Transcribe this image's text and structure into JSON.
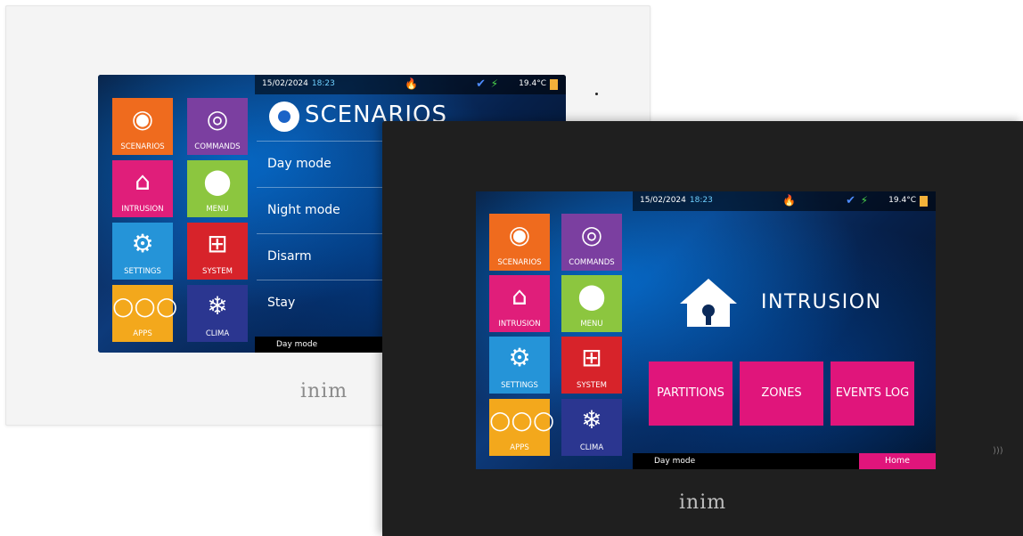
{
  "brand": "inim",
  "status": {
    "date": "15/02/2024",
    "time": "18:23",
    "temperature": "19.4°C"
  },
  "tiles": [
    {
      "label": "SCENARIOS",
      "icon": "eye-icon",
      "color": "#ef6b1e"
    },
    {
      "label": "COMMANDS",
      "icon": "touch-icon",
      "color": "#7b3fa0"
    },
    {
      "label": "INTRUSION",
      "icon": "house-icon",
      "color": "#e01e7a"
    },
    {
      "label": "MENU",
      "icon": "map-pin-icon",
      "color": "#8cc63f"
    },
    {
      "label": "SETTINGS",
      "icon": "gear-icon",
      "color": "#2594d8"
    },
    {
      "label": "SYSTEM",
      "icon": "network-icon",
      "color": "#d7232a"
    },
    {
      "label": "APPS",
      "icon": "dots-icon",
      "color": "#f3a81c"
    },
    {
      "label": "CLIMA",
      "icon": "snowflake-icon",
      "color": "#2b3690"
    }
  ],
  "scenarios_screen": {
    "title": "SCENARIOS",
    "items": [
      "Day mode",
      "Night mode",
      "Disarm",
      "Stay"
    ],
    "footer": "Day mode"
  },
  "intrusion_screen": {
    "title": "INTRUSION",
    "buttons": [
      "PARTITIONS",
      "ZONES",
      "EVENTS LOG"
    ],
    "footer": "Day mode",
    "home": "Home"
  }
}
